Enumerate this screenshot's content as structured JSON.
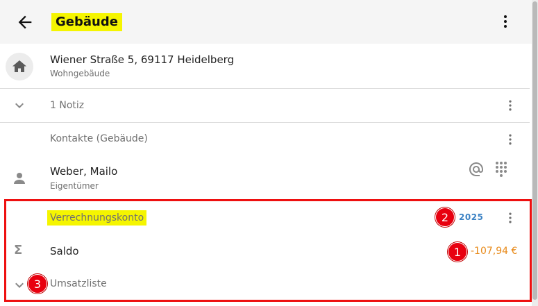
{
  "appbar": {
    "title": "Gebäude",
    "back_icon": "arrow-back-icon",
    "menu_icon": "more-vert-icon"
  },
  "building": {
    "address": "Wiener Straße 5, 69117 Heidelberg",
    "type": "Wohngebäude",
    "icon": "home-icon"
  },
  "notes": {
    "label": "1 Notiz",
    "icon": "chevron-down-icon"
  },
  "contacts": {
    "section_label": "Kontakte (Gebäude)",
    "items": [
      {
        "name": "Weber, Mailo",
        "role": "Eigentümer",
        "icon": "person-icon",
        "actions": [
          "at-icon",
          "dialpad-icon"
        ]
      }
    ]
  },
  "account": {
    "label": "Verrechnungskonto",
    "year": "2025",
    "balance_label": "Saldo",
    "balance_value": "-107,94 €",
    "balance_icon": "sigma-icon",
    "transactions_label": "Umsatzliste",
    "transactions_icon": "chevron-down-icon"
  },
  "annotations": [
    {
      "number": "1"
    },
    {
      "number": "2"
    },
    {
      "number": "3"
    }
  ],
  "colors": {
    "highlight": "#f5f500",
    "annotation_red": "#e8000f",
    "year_blue": "#3b82c4",
    "amount_orange": "#e88a1a"
  }
}
